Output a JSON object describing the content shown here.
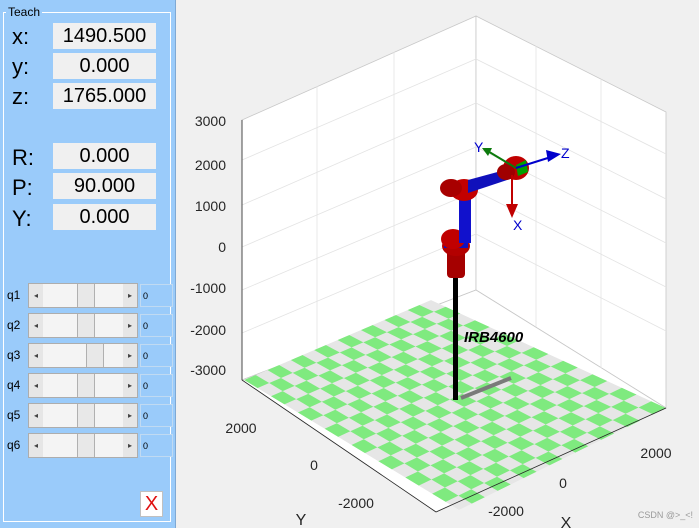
{
  "panel": {
    "title": "Teach",
    "position": [
      {
        "label": "x:",
        "value": "1490.500"
      },
      {
        "label": "y:",
        "value": "0.000"
      },
      {
        "label": "z:",
        "value": "1765.000"
      }
    ],
    "orientation": [
      {
        "label": "R:",
        "value": "0.000"
      },
      {
        "label": "P:",
        "value": "90.000"
      },
      {
        "label": "Y:",
        "value": "0.000"
      }
    ],
    "joints": [
      {
        "label": "q1",
        "value": "0",
        "fraction": 0.55
      },
      {
        "label": "q2",
        "value": "0",
        "fraction": 0.55
      },
      {
        "label": "q3",
        "value": "0",
        "fraction": 0.7
      },
      {
        "label": "q4",
        "value": "0",
        "fraction": 0.55
      },
      {
        "label": "q5",
        "value": "0",
        "fraction": 0.55
      },
      {
        "label": "q6",
        "value": "0",
        "fraction": 0.55
      }
    ],
    "close_label": "X"
  },
  "axes": {
    "z_ticks": [
      "3000",
      "2000",
      "1000",
      "0",
      "-1000",
      "-2000",
      "-3000"
    ],
    "y_ticks": [
      "2000",
      "0",
      "-2000"
    ],
    "y_label": "Y",
    "x_ticks": [
      "-2000",
      "0",
      "2000"
    ],
    "x_label": "X"
  },
  "robot": {
    "name": "IRB4600",
    "frame_labels": {
      "top_y": "Y",
      "z": "Z",
      "x": "X"
    },
    "colors": {
      "link": "#b30000",
      "joint": "#0000cc",
      "base": "#000000",
      "checker_a": "#7fea7f",
      "checker_b": "#e6e6e6"
    }
  },
  "watermark": "CSDN @>_<!"
}
